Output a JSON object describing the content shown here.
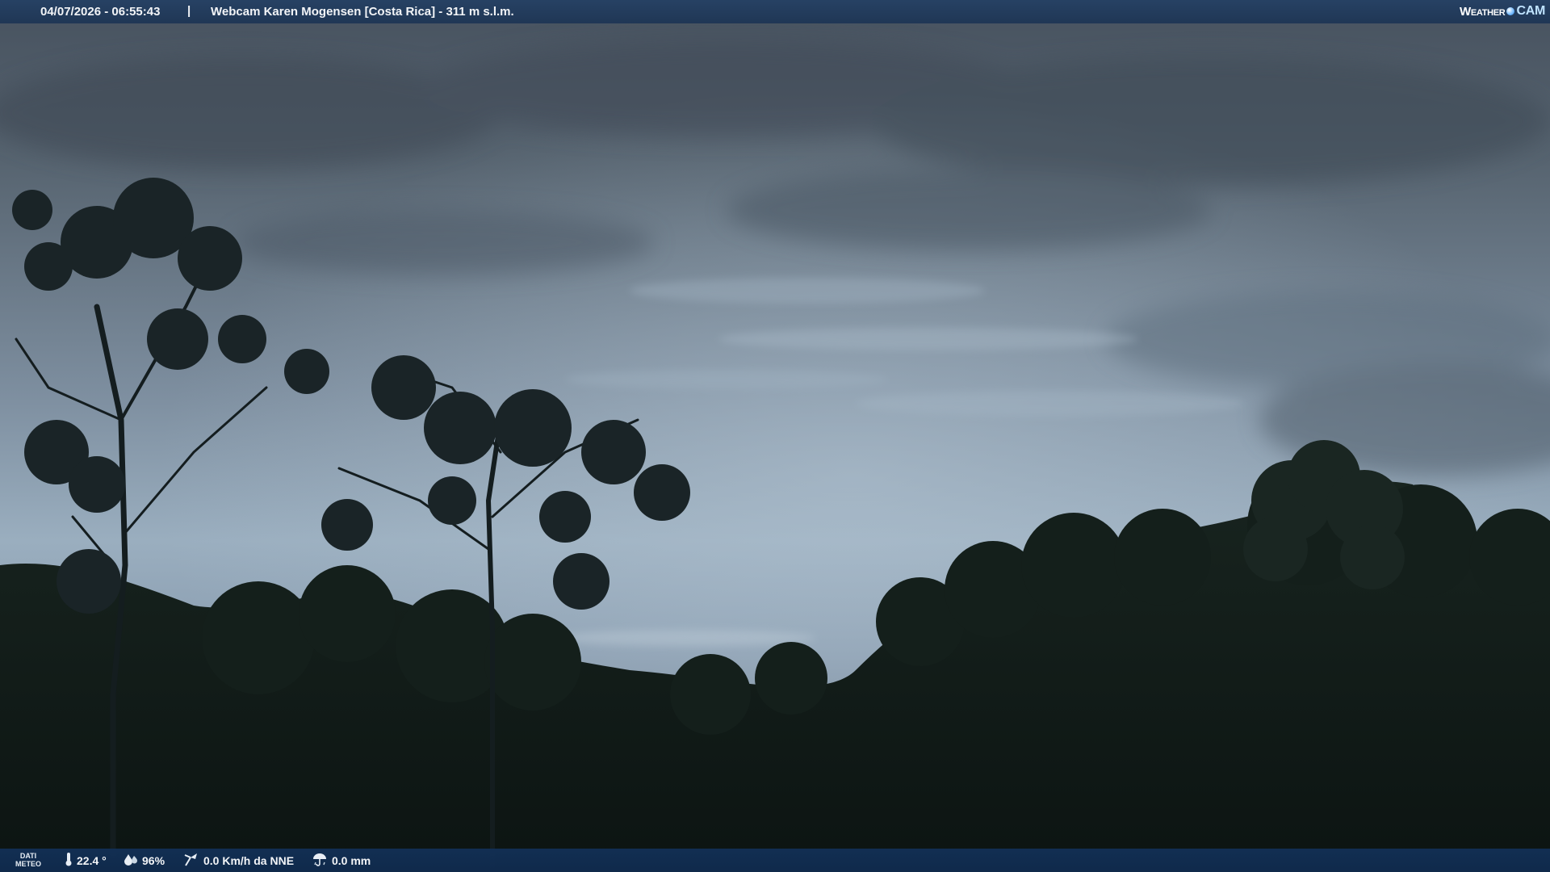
{
  "overlay": {
    "datetime": "04/07/2026 - 06:55:43",
    "separator": "|",
    "title": "Webcam Karen Mogensen [Costa Rica]  - 311 m s.l.m.",
    "logo": {
      "weather": "Weather",
      "cam": "CAM"
    }
  },
  "meteo": {
    "label_line1": "DATI",
    "label_line2": "METEO",
    "temperature": "22.4 °",
    "humidity": "96%",
    "wind": "0.0 Km/h da NNE",
    "rain": "0.0 mm",
    "icons": [
      "thermometer-icon",
      "humidity-icon",
      "wind-icon",
      "rain-icon"
    ]
  },
  "colors": {
    "bar": "#1c3454",
    "sky_top": "#45505e",
    "sky_mid": "#8fa3b6",
    "foliage": "#0f1a17"
  }
}
